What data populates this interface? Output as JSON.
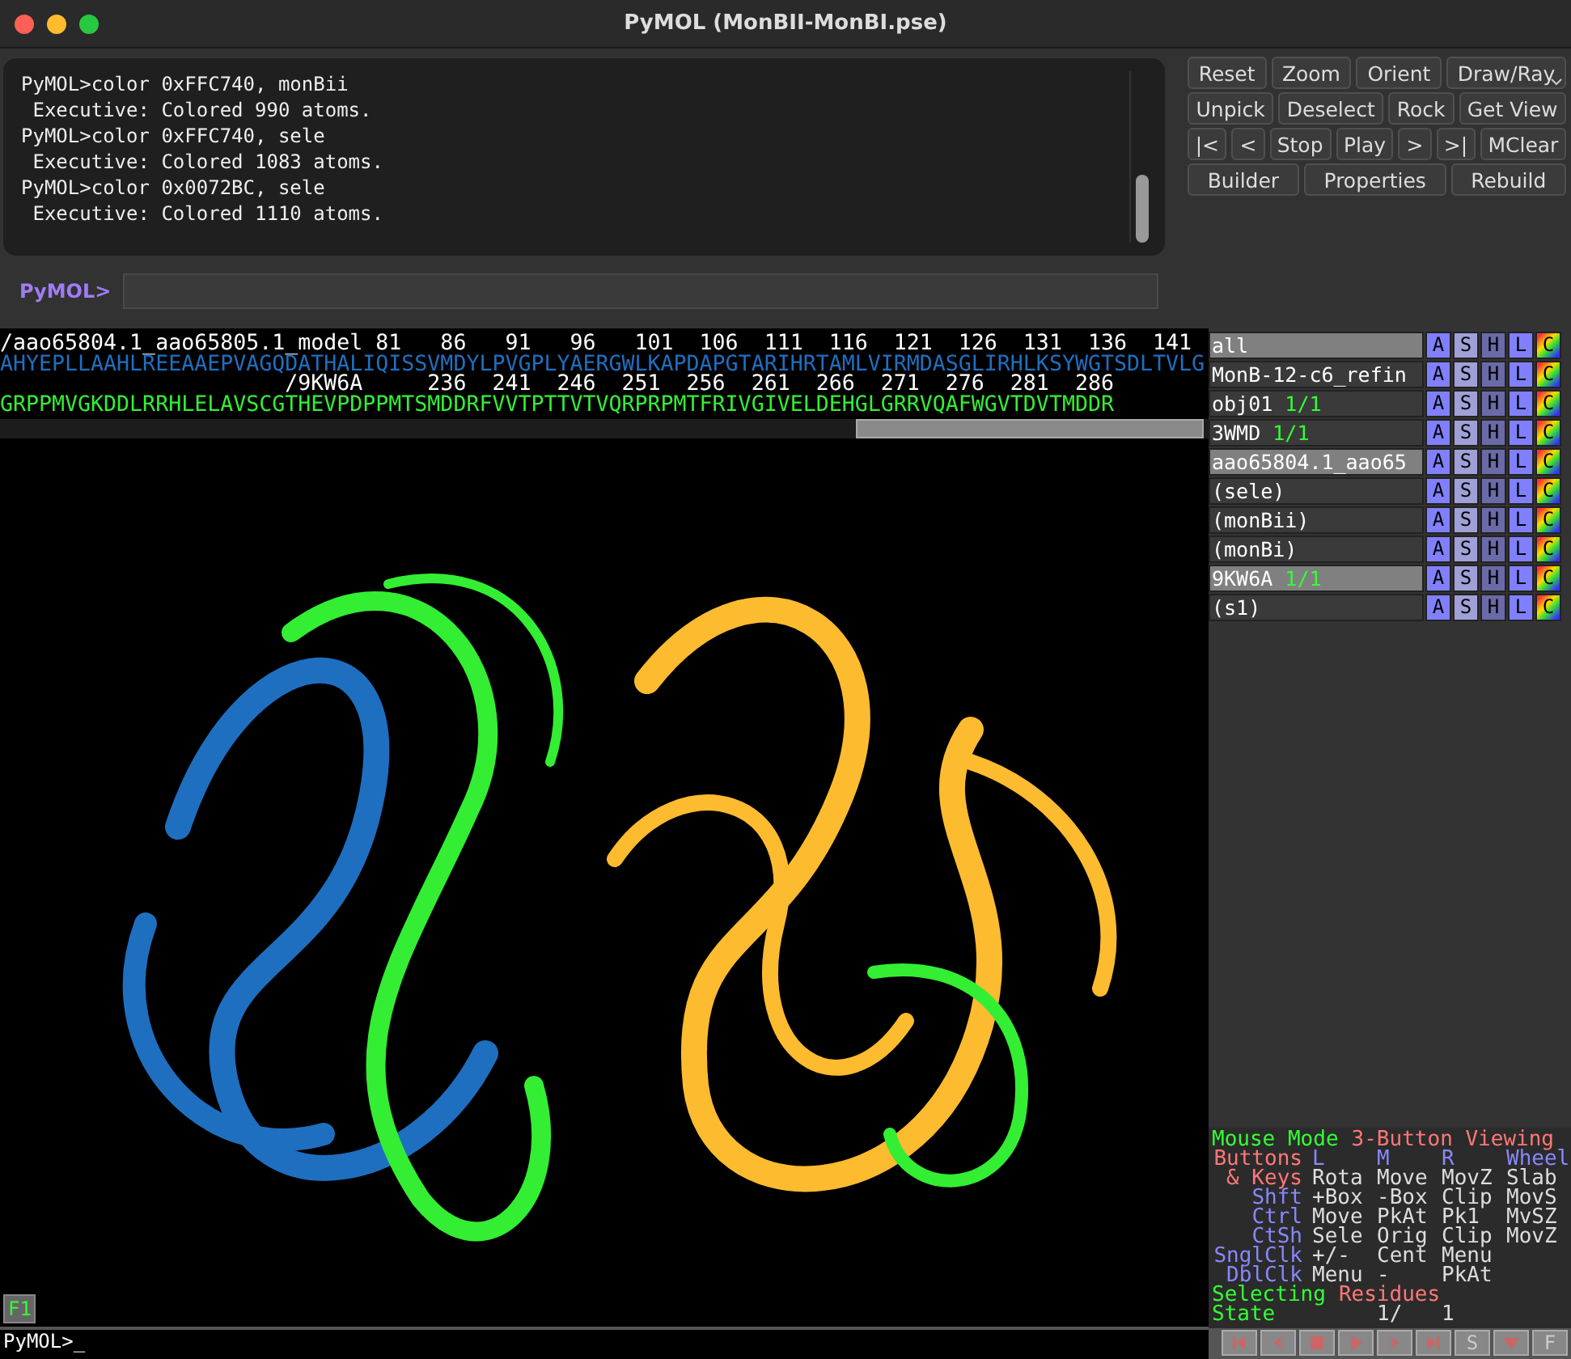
{
  "window": {
    "title": "PyMOL (MonBII-MonBI.pse)"
  },
  "console": {
    "lines": [
      "PyMOL>color 0xFFC740, monBii",
      " Executive: Colored 990 atoms.",
      "PyMOL>color 0xFFC740, sele",
      " Executive: Colored 1083 atoms.",
      "PyMOL>color 0x0072BC, sele",
      " Executive: Colored 1110 atoms."
    ]
  },
  "command_prompt": {
    "label": "PyMOL>"
  },
  "toolbar": {
    "rows": [
      {
        "buttons": [
          {
            "label": "Reset",
            "dropdown": false
          },
          {
            "label": "Zoom",
            "dropdown": false
          },
          {
            "label": "Orient",
            "dropdown": false
          },
          {
            "label": "Draw/Ray",
            "dropdown": true
          }
        ]
      },
      {
        "buttons": [
          {
            "label": "Unpick",
            "dropdown": false
          },
          {
            "label": "Deselect",
            "dropdown": false
          },
          {
            "label": "Rock",
            "dropdown": false
          },
          {
            "label": "Get View",
            "dropdown": false
          }
        ]
      },
      {
        "buttons": [
          {
            "label": "|<",
            "dropdown": false
          },
          {
            "label": "<",
            "dropdown": false
          },
          {
            "label": "Stop",
            "dropdown": false
          },
          {
            "label": "Play",
            "dropdown": false
          },
          {
            "label": ">",
            "dropdown": false
          },
          {
            "label": ">|",
            "dropdown": false
          },
          {
            "label": "MClear",
            "dropdown": false
          }
        ]
      },
      {
        "buttons": [
          {
            "label": "Builder",
            "dropdown": false
          },
          {
            "label": "Properties",
            "dropdown": false
          },
          {
            "label": "Rebuild",
            "dropdown": false
          }
        ]
      }
    ]
  },
  "sequence": {
    "rows": [
      {
        "kind": "header",
        "text": "/aao65804.1_aao65805.1_model 81   86   91   96   101  106  111  116  121  126  131  136  141"
      },
      {
        "kind": "residues",
        "color": "#1f6fc0",
        "text": "AHYEPLLAAHLREEAAEPVAGQDATHALIQISSVMDYLPVGPLYAERGWLKAPDAPGTARIHRTAMLVIRMDASGLIRHLKSYWGTSDLTVLG"
      },
      {
        "kind": "header",
        "text": "                      /9KW6A     236  241  246  251  256  261  266  271  276  281  286"
      },
      {
        "kind": "residues",
        "color": "#33ee33",
        "text": "GRPPMVGKDDLRRHLELAVSCGTHEVPDPPMTSMDDRFVVTPTTVTVQRPRPMTFRIVGIVELDEHGLGRRVQAFWGVTDVTMDDR"
      }
    ]
  },
  "viewer": {
    "badge": "F1"
  },
  "command_line": {
    "text": "PyMOL>_"
  },
  "objects": [
    {
      "name": "all",
      "enabled": true,
      "actions": [
        "A",
        "S",
        "H",
        "L",
        "C"
      ]
    },
    {
      "name": "MonB-12-c6_refin",
      "enabled": false,
      "actions": [
        "A",
        "S",
        "H",
        "L",
        "C"
      ]
    },
    {
      "name": "obj01",
      "state": "1/1",
      "enabled": false,
      "actions": [
        "A",
        "S",
        "H",
        "L",
        "C"
      ]
    },
    {
      "name": "3WMD",
      "state": "1/1",
      "enabled": false,
      "actions": [
        "A",
        "S",
        "H",
        "L",
        "C"
      ]
    },
    {
      "name": "aao65804.1_aao65",
      "enabled": true,
      "actions": [
        "A",
        "S",
        "H",
        "L",
        "C"
      ]
    },
    {
      "name": "(sele)",
      "enabled": false,
      "actions": [
        "A",
        "S",
        "H",
        "L",
        "C"
      ]
    },
    {
      "name": "(monBii)",
      "enabled": false,
      "actions": [
        "A",
        "S",
        "H",
        "L",
        "C"
      ]
    },
    {
      "name": "(monBi)",
      "enabled": false,
      "actions": [
        "A",
        "S",
        "H",
        "L",
        "C"
      ]
    },
    {
      "name": "9KW6A",
      "state": "1/1",
      "enabled": true,
      "actions": [
        "A",
        "S",
        "H",
        "L",
        "C"
      ]
    },
    {
      "name": "(s1)",
      "enabled": false,
      "actions": [
        "A",
        "S",
        "H",
        "L",
        "C"
      ]
    }
  ],
  "mouse_mode": {
    "label": "Mouse Mode",
    "value": "3-Button Viewing",
    "header": [
      "Buttons",
      "L",
      "M",
      "R",
      "Wheel"
    ],
    "rows": [
      {
        "key": "& Keys",
        "kind": "keys",
        "actions": [
          "Rota",
          "Move",
          "MovZ",
          "Slab"
        ]
      },
      {
        "key": "Shft",
        "kind": "modifier",
        "actions": [
          "+Box",
          "-Box",
          "Clip",
          "MovS"
        ]
      },
      {
        "key": "Ctrl",
        "kind": "modifier",
        "actions": [
          "Move",
          "PkAt",
          "Pk1",
          "MvSZ"
        ]
      },
      {
        "key": "CtSh",
        "kind": "modifier",
        "actions": [
          "Sele",
          "Orig",
          "Clip",
          "MovZ"
        ]
      },
      {
        "key": "SnglClk",
        "kind": "modifier",
        "actions": [
          "+/-",
          "Cent",
          "Menu"
        ]
      },
      {
        "key": "DblClk",
        "kind": "modifier",
        "actions": [
          "Menu",
          "-",
          "PkAt"
        ]
      }
    ],
    "selecting_label": "Selecting",
    "selecting_value": "Residues",
    "state_label": "State",
    "state_value": "1/",
    "state_total": "1"
  },
  "movie_controls": [
    {
      "kind": "first"
    },
    {
      "kind": "prev"
    },
    {
      "kind": "stop"
    },
    {
      "kind": "play"
    },
    {
      "kind": "next"
    },
    {
      "kind": "last"
    },
    {
      "kind": "text",
      "label": "S"
    },
    {
      "kind": "menu"
    },
    {
      "kind": "text",
      "label": "F"
    }
  ]
}
